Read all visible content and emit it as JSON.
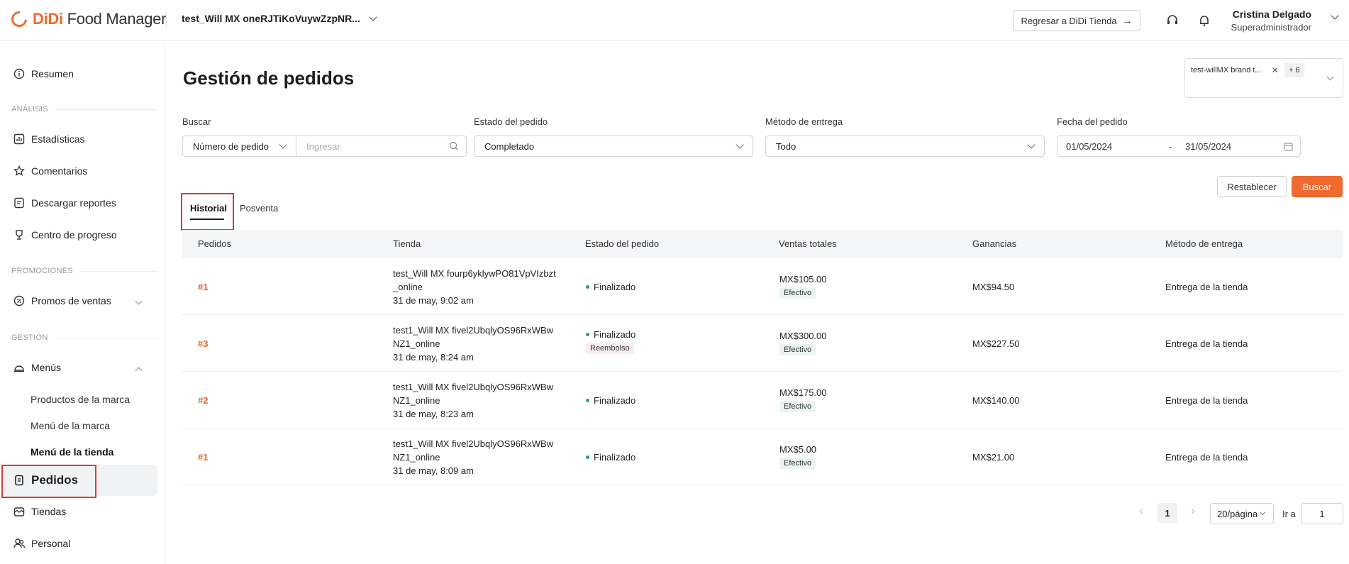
{
  "header": {
    "logo_brand": "DiDi",
    "logo_product": "Food Manager",
    "store_name": "test_Will MX oneRJTiKoVuywZzpNR...",
    "back_button": "Regresar a DiDi Tienda",
    "back_arrow": "→",
    "user_name": "Cristina Delgado",
    "user_role": "Superadministrador"
  },
  "sidebar": {
    "summary": "Resumen",
    "section_analysis": "ANÁLISIS",
    "stats": "Estadísticas",
    "comments": "Comentarios",
    "reports": "Descargar reportes",
    "progress": "Centro de progreso",
    "section_promotions": "PROMOCIONES",
    "promos": "Promos de ventas",
    "section_management": "GESTIÓN",
    "menus": "Menús",
    "brand_products": "Productos de la marca",
    "brand_menu": "Menú de la marca",
    "store_menu": "Menú de la tienda",
    "orders": "Pedidos",
    "stores": "Tiendas",
    "staff": "Personal"
  },
  "main": {
    "title": "Gestión de pedidos",
    "brand_filter": {
      "chip": "test-willMX brand t...",
      "close": "✕",
      "more": "+ 6"
    },
    "filters": {
      "search_label": "Buscar",
      "search_type": "Número de pedido",
      "search_placeholder": "Ingresar",
      "status_label": "Estado del pedido",
      "status_value": "Completado",
      "delivery_label": "Método de entrega",
      "delivery_value": "Todo",
      "date_label": "Fecha del pedido",
      "date_from": "01/05/2024",
      "date_sep": "-",
      "date_to": "31/05/2024"
    },
    "buttons": {
      "reset": "Restablecer",
      "search": "Buscar"
    },
    "tabs": [
      "Historial",
      "Posventa"
    ],
    "table": {
      "headers": [
        "Pedidos",
        "Tienda",
        "Estado del pedido",
        "Ventas totales",
        "Ganancias",
        "Método de entrega"
      ],
      "rows": [
        {
          "id": "#1",
          "store1": "test_Will MX fourp6yklywPO81VpVIzbzt",
          "store2": "_online",
          "date": "31 de may, 9:02 am",
          "status": "Finalizado",
          "status_tag": "",
          "total": "MX$105.00",
          "payment": "Efectivo",
          "earnings": "MX$94.50",
          "delivery": "Entrega de la tienda"
        },
        {
          "id": "#3",
          "store1": "test1_Will MX fivel2UbqlyOS96RxWBw",
          "store2": "NZ1_online",
          "date": "31 de may, 8:24 am",
          "status": "Finalizado",
          "status_tag": "Reembolso",
          "total": "MX$300.00",
          "payment": "Efectivo",
          "earnings": "MX$227.50",
          "delivery": "Entrega de la tienda"
        },
        {
          "id": "#2",
          "store1": "test1_Will MX fivel2UbqlyOS96RxWBw",
          "store2": "NZ1_online",
          "date": "31 de may, 8:23 am",
          "status": "Finalizado",
          "status_tag": "",
          "total": "MX$175.00",
          "payment": "Efectivo",
          "earnings": "MX$140.00",
          "delivery": "Entrega de la tienda"
        },
        {
          "id": "#1",
          "store1": "test1_Will MX fivel2UbqlyOS96RxWBw",
          "store2": "NZ1_online",
          "date": "31 de may, 8:09 am",
          "status": "Finalizado",
          "status_tag": "",
          "total": "MX$5.00",
          "payment": "Efectivo",
          "earnings": "MX$21.00",
          "delivery": "Entrega de la tienda"
        }
      ]
    },
    "pagination": {
      "prev": "‹",
      "next": "›",
      "current_page": "1",
      "page_size": "20/página",
      "goto_label": "Ir a",
      "goto_value": "1"
    }
  },
  "colors": {
    "accent": "#ee6a2f",
    "status_green": "#23a45a",
    "highlight_red": "#d93a3a"
  }
}
